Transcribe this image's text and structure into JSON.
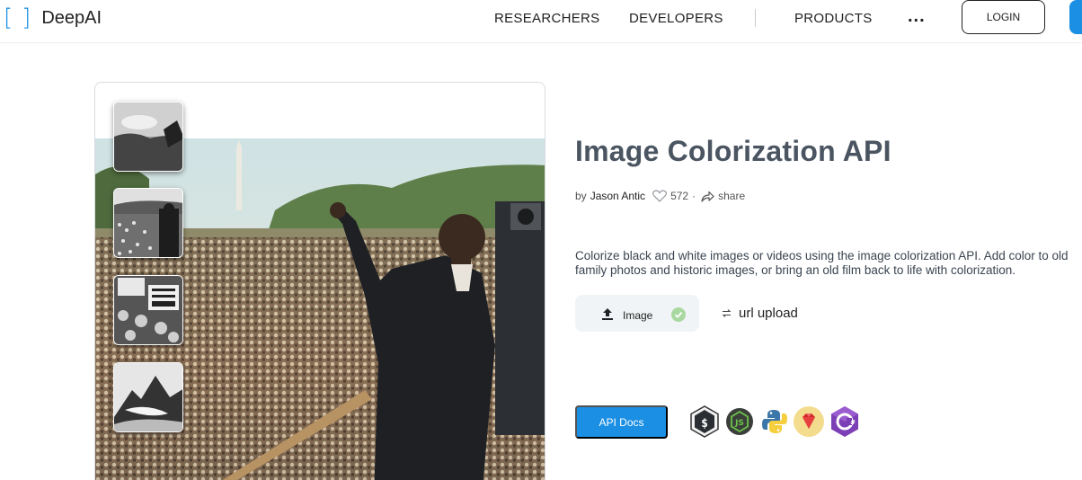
{
  "brand": {
    "bracket_left": "[",
    "bracket_right": "]",
    "name": "DeepAI",
    "accent_color": "#1a8fe3"
  },
  "nav": {
    "items": [
      {
        "label": "RESEARCHERS"
      },
      {
        "label": "DEVELOPERS"
      },
      {
        "label": "PRODUCTS"
      }
    ],
    "more_label": "...",
    "login_label": "LOGIN"
  },
  "hero": {
    "thumbnails": [
      {
        "icon": "landscape-photo"
      },
      {
        "icon": "march-crowd-photo"
      },
      {
        "icon": "protest-sign-photo"
      },
      {
        "icon": "mountain-photo"
      }
    ],
    "main_image_icon": "colorized-speech-photo"
  },
  "api": {
    "title": "Image Colorization API",
    "by_label": "by",
    "author": "Jason Antic",
    "likes": "572",
    "share_label": "share",
    "description": "Colorize black and white images or videos using the image colorization API. Add color to old family photos and historic images, or bring an old film back to life with colorization.",
    "tabs": {
      "image_label": "Image",
      "url_label": "url upload"
    },
    "docs_label": "API Docs",
    "languages": [
      {
        "name": "shell-icon"
      },
      {
        "name": "nodejs-icon"
      },
      {
        "name": "python-icon"
      },
      {
        "name": "ruby-icon"
      },
      {
        "name": "csharp-icon"
      }
    ]
  }
}
